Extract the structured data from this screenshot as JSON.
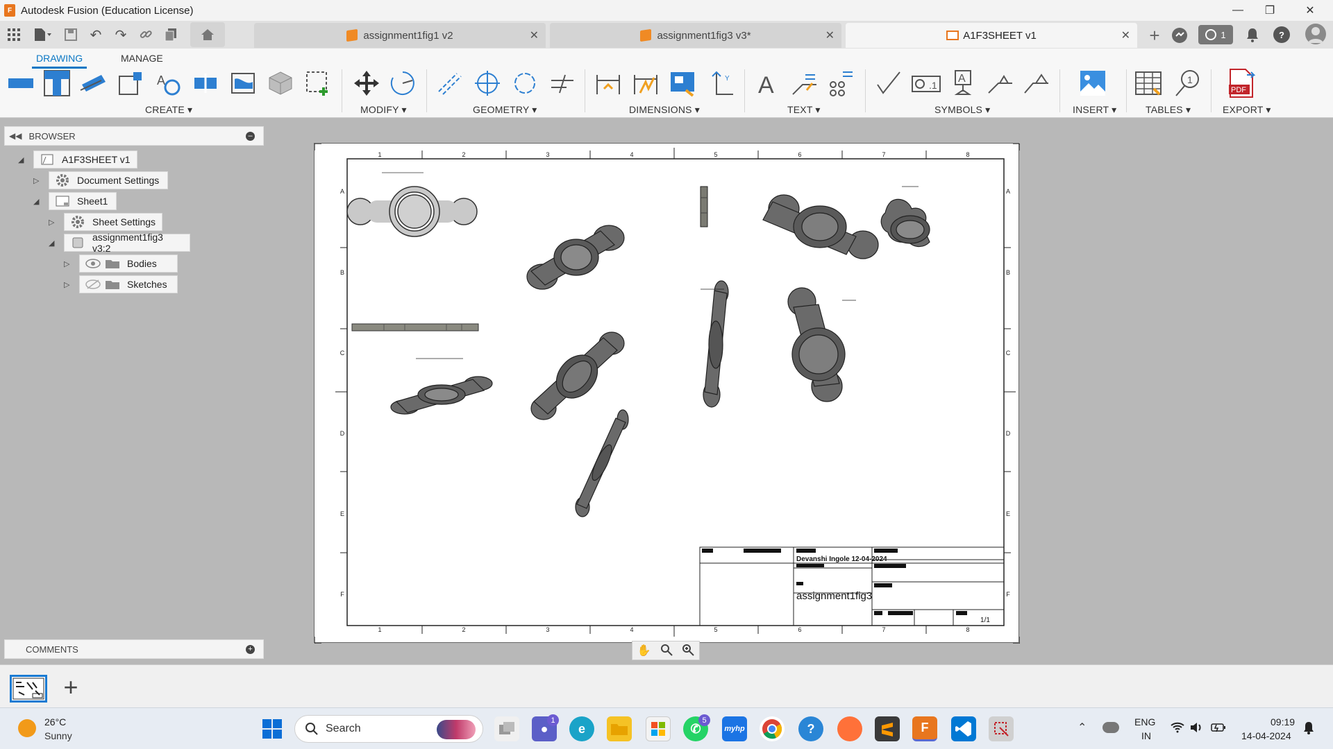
{
  "window": {
    "title": "Autodesk Fusion (Education License)",
    "app_badge": "F"
  },
  "tabs": [
    {
      "label": "assignment1fig1 v2"
    },
    {
      "label": "assignment1fig3 v3*"
    },
    {
      "label": "A1F3SHEET v1"
    }
  ],
  "toolbar_right": {
    "jobs_count": "1"
  },
  "ribbon": {
    "tabs": [
      "DRAWING",
      "MANAGE"
    ],
    "groups": [
      "CREATE ▾",
      "MODIFY ▾",
      "GEOMETRY ▾",
      "DIMENSIONS ▾",
      "TEXT ▾",
      "SYMBOLS ▾",
      "INSERT ▾",
      "TABLES ▾",
      "EXPORT ▾"
    ],
    "pdf_label": "PDF"
  },
  "browser": {
    "title": "BROWSER",
    "root": "A1F3SHEET v1",
    "items": [
      {
        "label": "Document Settings"
      },
      {
        "label": "Sheet1"
      },
      {
        "label": "Sheet Settings"
      },
      {
        "label": "assignment1fig3 v3:2"
      },
      {
        "label": "Bodies"
      },
      {
        "label": "Sketches"
      }
    ]
  },
  "comments": {
    "title": "COMMENTS"
  },
  "sheet": {
    "col_labels": [
      "1",
      "2",
      "3",
      "4",
      "5",
      "6",
      "7",
      "8"
    ],
    "row_labels": [
      "A",
      "B",
      "C",
      "D",
      "E",
      "F"
    ],
    "title_block": {
      "author_date": "Devanshi Ingole  12-04-2024",
      "title": "assignment1fig3",
      "sheet_no": "1/1"
    }
  },
  "taskbar": {
    "weather": {
      "temp": "26°C",
      "condition": "Sunny"
    },
    "search_placeholder": "Search",
    "teams_badge": "1",
    "whatsapp_badge": "5",
    "myhp": "myhp",
    "lang": {
      "line1": "ENG",
      "line2": "IN"
    },
    "clock": {
      "time": "09:19",
      "date": "14-04-2024"
    }
  }
}
